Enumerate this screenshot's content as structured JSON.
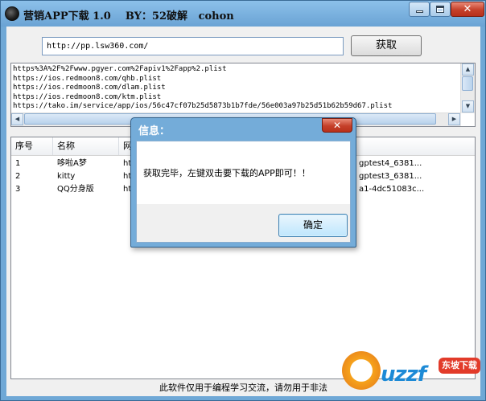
{
  "window": {
    "title": "营销APP下载 1.0    BY：52破解   cohon",
    "close_glyph": "✕"
  },
  "toolbar": {
    "url_value": "http://pp.lsw360.com/",
    "fetch_label": "获取"
  },
  "link_list": {
    "lines": [
      "https%3A%2F%2Fwww.pgyer.com%2Fapiv1%2Fapp%2.plist",
      "https://ios.redmoon8.com/qhb.plist",
      "https://ios.redmoon8.com/dlam.plist",
      "https://ios.redmoon8.com/ktm.plist",
      "https://tako.im/service/app/ios/56c47cf07b25d5873b1b7fde/56e003a97b25d51b62b59d67.plist"
    ]
  },
  "table": {
    "columns": [
      "序号",
      "名称",
      "网"
    ],
    "rows": [
      {
        "no": "1",
        "name": "哆啦A梦",
        "url": "ht",
        "tail": "gptest4_6381..."
      },
      {
        "no": "2",
        "name": "kitty",
        "url": "ht",
        "tail": "gptest3_6381..."
      },
      {
        "no": "3",
        "name": "QQ分身版",
        "url": "ht",
        "tail": "a1-4dc51083c..."
      }
    ]
  },
  "footer": {
    "text": "此软件仅用于编程学习交流，请勿用于非法"
  },
  "dialog": {
    "title": "信息：",
    "message": "获取完毕，左键双击要下载的APP即可！！",
    "ok_label": "确定",
    "close_glyph": "✕"
  },
  "watermark": {
    "logo_text": "uzzf",
    "site_tag": "东坡下载"
  },
  "colors": {
    "title_bar": "#6fa8d6",
    "close_button": "#c5402a",
    "dialog_frame": "#74acd9"
  },
  "icons": [
    "app-icon",
    "minimize-icon",
    "maximize-icon",
    "close-icon",
    "scroll-up-icon",
    "scroll-down-icon",
    "scroll-left-icon",
    "scroll-right-icon"
  ]
}
